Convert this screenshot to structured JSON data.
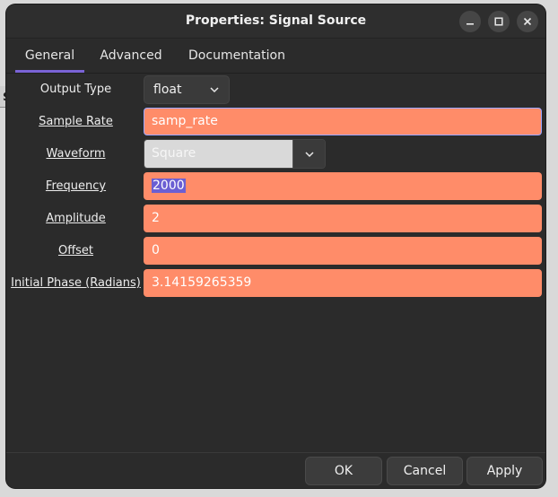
{
  "window": {
    "title": "Properties: Signal Source"
  },
  "tabs": [
    {
      "label": "General",
      "active": true
    },
    {
      "label": "Advanced",
      "active": false
    },
    {
      "label": "Documentation",
      "active": false
    }
  ],
  "form": {
    "output_type": {
      "label": "Output Type",
      "value": "float"
    },
    "sample_rate": {
      "label": "Sample Rate",
      "value": "samp_rate"
    },
    "waveform": {
      "label": "Waveform",
      "value": "Square"
    },
    "frequency": {
      "label": "Frequency",
      "value": "2000"
    },
    "amplitude": {
      "label": "Amplitude",
      "value": "2"
    },
    "offset": {
      "label": "Offset",
      "value": "0"
    },
    "initial_phase": {
      "label": "Initial Phase (Radians)",
      "value": "3.14159265359"
    }
  },
  "footer": {
    "ok": "OK",
    "cancel": "Cancel",
    "apply": "Apply"
  },
  "colors": {
    "field_bg": "#ff8c69",
    "accent": "#7a63d6",
    "window_bg": "#2b2b2b"
  },
  "icons": [
    "minimize-icon",
    "maximize-icon",
    "close-icon",
    "chevron-down-icon"
  ]
}
